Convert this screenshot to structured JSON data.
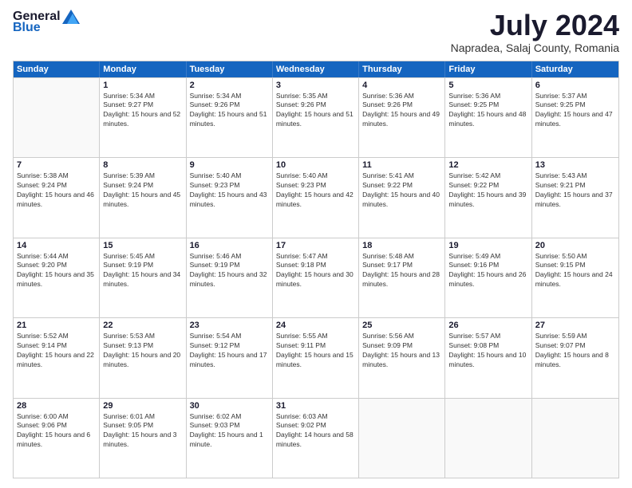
{
  "logo": {
    "general": "General",
    "blue": "Blue"
  },
  "title": "July 2024",
  "location": "Napradea, Salaj County, Romania",
  "days": [
    "Sunday",
    "Monday",
    "Tuesday",
    "Wednesday",
    "Thursday",
    "Friday",
    "Saturday"
  ],
  "weeks": [
    [
      {
        "date": "",
        "sunrise": "",
        "sunset": "",
        "daylight": ""
      },
      {
        "date": "1",
        "sunrise": "Sunrise: 5:34 AM",
        "sunset": "Sunset: 9:27 PM",
        "daylight": "Daylight: 15 hours and 52 minutes."
      },
      {
        "date": "2",
        "sunrise": "Sunrise: 5:34 AM",
        "sunset": "Sunset: 9:26 PM",
        "daylight": "Daylight: 15 hours and 51 minutes."
      },
      {
        "date": "3",
        "sunrise": "Sunrise: 5:35 AM",
        "sunset": "Sunset: 9:26 PM",
        "daylight": "Daylight: 15 hours and 51 minutes."
      },
      {
        "date": "4",
        "sunrise": "Sunrise: 5:36 AM",
        "sunset": "Sunset: 9:26 PM",
        "daylight": "Daylight: 15 hours and 49 minutes."
      },
      {
        "date": "5",
        "sunrise": "Sunrise: 5:36 AM",
        "sunset": "Sunset: 9:25 PM",
        "daylight": "Daylight: 15 hours and 48 minutes."
      },
      {
        "date": "6",
        "sunrise": "Sunrise: 5:37 AM",
        "sunset": "Sunset: 9:25 PM",
        "daylight": "Daylight: 15 hours and 47 minutes."
      }
    ],
    [
      {
        "date": "7",
        "sunrise": "Sunrise: 5:38 AM",
        "sunset": "Sunset: 9:24 PM",
        "daylight": "Daylight: 15 hours and 46 minutes."
      },
      {
        "date": "8",
        "sunrise": "Sunrise: 5:39 AM",
        "sunset": "Sunset: 9:24 PM",
        "daylight": "Daylight: 15 hours and 45 minutes."
      },
      {
        "date": "9",
        "sunrise": "Sunrise: 5:40 AM",
        "sunset": "Sunset: 9:23 PM",
        "daylight": "Daylight: 15 hours and 43 minutes."
      },
      {
        "date": "10",
        "sunrise": "Sunrise: 5:40 AM",
        "sunset": "Sunset: 9:23 PM",
        "daylight": "Daylight: 15 hours and 42 minutes."
      },
      {
        "date": "11",
        "sunrise": "Sunrise: 5:41 AM",
        "sunset": "Sunset: 9:22 PM",
        "daylight": "Daylight: 15 hours and 40 minutes."
      },
      {
        "date": "12",
        "sunrise": "Sunrise: 5:42 AM",
        "sunset": "Sunset: 9:22 PM",
        "daylight": "Daylight: 15 hours and 39 minutes."
      },
      {
        "date": "13",
        "sunrise": "Sunrise: 5:43 AM",
        "sunset": "Sunset: 9:21 PM",
        "daylight": "Daylight: 15 hours and 37 minutes."
      }
    ],
    [
      {
        "date": "14",
        "sunrise": "Sunrise: 5:44 AM",
        "sunset": "Sunset: 9:20 PM",
        "daylight": "Daylight: 15 hours and 35 minutes."
      },
      {
        "date": "15",
        "sunrise": "Sunrise: 5:45 AM",
        "sunset": "Sunset: 9:19 PM",
        "daylight": "Daylight: 15 hours and 34 minutes."
      },
      {
        "date": "16",
        "sunrise": "Sunrise: 5:46 AM",
        "sunset": "Sunset: 9:19 PM",
        "daylight": "Daylight: 15 hours and 32 minutes."
      },
      {
        "date": "17",
        "sunrise": "Sunrise: 5:47 AM",
        "sunset": "Sunset: 9:18 PM",
        "daylight": "Daylight: 15 hours and 30 minutes."
      },
      {
        "date": "18",
        "sunrise": "Sunrise: 5:48 AM",
        "sunset": "Sunset: 9:17 PM",
        "daylight": "Daylight: 15 hours and 28 minutes."
      },
      {
        "date": "19",
        "sunrise": "Sunrise: 5:49 AM",
        "sunset": "Sunset: 9:16 PM",
        "daylight": "Daylight: 15 hours and 26 minutes."
      },
      {
        "date": "20",
        "sunrise": "Sunrise: 5:50 AM",
        "sunset": "Sunset: 9:15 PM",
        "daylight": "Daylight: 15 hours and 24 minutes."
      }
    ],
    [
      {
        "date": "21",
        "sunrise": "Sunrise: 5:52 AM",
        "sunset": "Sunset: 9:14 PM",
        "daylight": "Daylight: 15 hours and 22 minutes."
      },
      {
        "date": "22",
        "sunrise": "Sunrise: 5:53 AM",
        "sunset": "Sunset: 9:13 PM",
        "daylight": "Daylight: 15 hours and 20 minutes."
      },
      {
        "date": "23",
        "sunrise": "Sunrise: 5:54 AM",
        "sunset": "Sunset: 9:12 PM",
        "daylight": "Daylight: 15 hours and 17 minutes."
      },
      {
        "date": "24",
        "sunrise": "Sunrise: 5:55 AM",
        "sunset": "Sunset: 9:11 PM",
        "daylight": "Daylight: 15 hours and 15 minutes."
      },
      {
        "date": "25",
        "sunrise": "Sunrise: 5:56 AM",
        "sunset": "Sunset: 9:09 PM",
        "daylight": "Daylight: 15 hours and 13 minutes."
      },
      {
        "date": "26",
        "sunrise": "Sunrise: 5:57 AM",
        "sunset": "Sunset: 9:08 PM",
        "daylight": "Daylight: 15 hours and 10 minutes."
      },
      {
        "date": "27",
        "sunrise": "Sunrise: 5:59 AM",
        "sunset": "Sunset: 9:07 PM",
        "daylight": "Daylight: 15 hours and 8 minutes."
      }
    ],
    [
      {
        "date": "28",
        "sunrise": "Sunrise: 6:00 AM",
        "sunset": "Sunset: 9:06 PM",
        "daylight": "Daylight: 15 hours and 6 minutes."
      },
      {
        "date": "29",
        "sunrise": "Sunrise: 6:01 AM",
        "sunset": "Sunset: 9:05 PM",
        "daylight": "Daylight: 15 hours and 3 minutes."
      },
      {
        "date": "30",
        "sunrise": "Sunrise: 6:02 AM",
        "sunset": "Sunset: 9:03 PM",
        "daylight": "Daylight: 15 hours and 1 minute."
      },
      {
        "date": "31",
        "sunrise": "Sunrise: 6:03 AM",
        "sunset": "Sunset: 9:02 PM",
        "daylight": "Daylight: 14 hours and 58 minutes."
      },
      {
        "date": "",
        "sunrise": "",
        "sunset": "",
        "daylight": ""
      },
      {
        "date": "",
        "sunrise": "",
        "sunset": "",
        "daylight": ""
      },
      {
        "date": "",
        "sunrise": "",
        "sunset": "",
        "daylight": ""
      }
    ]
  ]
}
